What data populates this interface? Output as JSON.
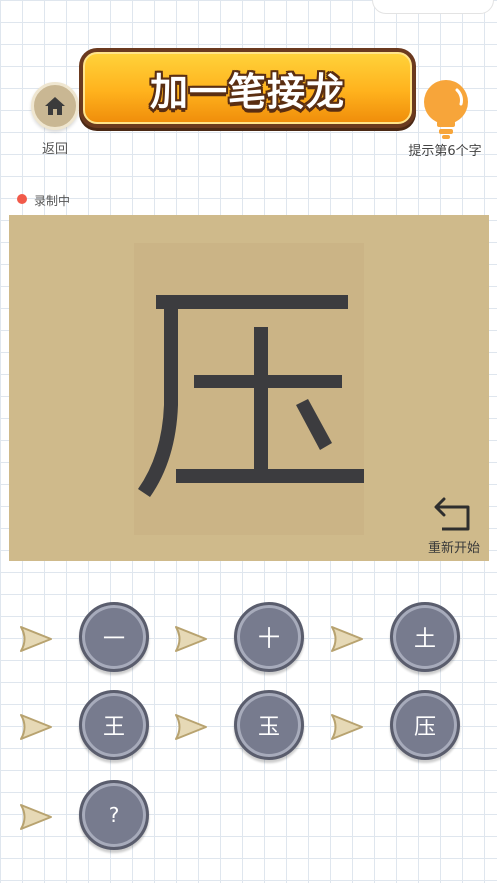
{
  "header": {
    "title": "加一笔接龙",
    "home_label": "返回",
    "hint_label": "提示第6个字"
  },
  "recording": {
    "label": "录制中",
    "color": "#f15a4a"
  },
  "board": {
    "current_char": "压",
    "restart_label": "重新开始",
    "background": "#cfba8b"
  },
  "chain": [
    {
      "char": "一"
    },
    {
      "char": "十"
    },
    {
      "char": "土"
    },
    {
      "char": "王"
    },
    {
      "char": "玉"
    },
    {
      "char": "压"
    },
    {
      "char": "?"
    }
  ],
  "colors": {
    "title_gradient_top": "#ffd23a",
    "title_gradient_bottom": "#f08e0b",
    "chain_button": "#777b8e",
    "bulb": "#f7a53a"
  }
}
